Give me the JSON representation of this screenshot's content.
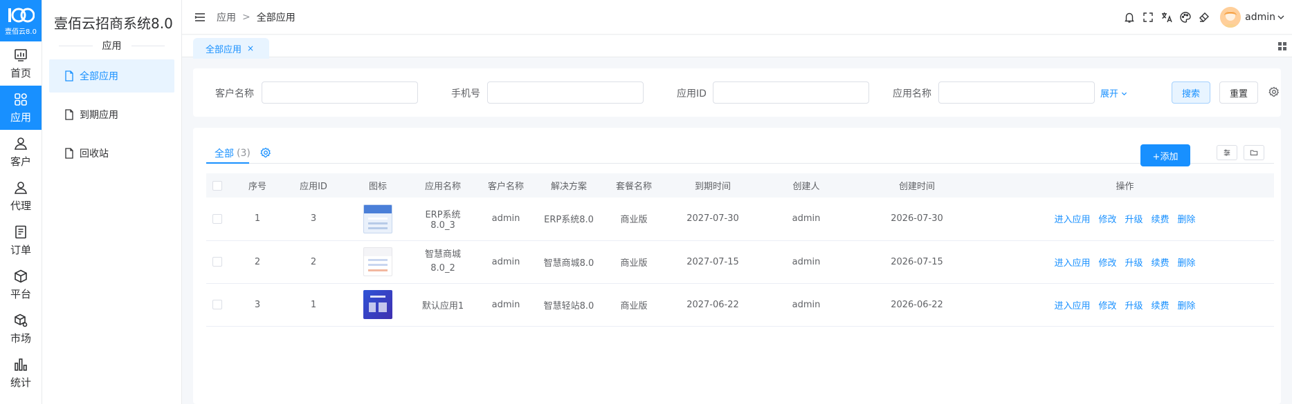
{
  "logo": {
    "text": "壹佰云8.0"
  },
  "rail": [
    {
      "id": "home",
      "label": "首页",
      "icon": "chart-icon",
      "active": false
    },
    {
      "id": "app",
      "label": "应用",
      "icon": "apps-grid-icon",
      "active": true
    },
    {
      "id": "customer",
      "label": "客户",
      "icon": "user-icon",
      "active": false
    },
    {
      "id": "agent",
      "label": "代理",
      "icon": "user-outline-icon",
      "active": false
    },
    {
      "id": "order",
      "label": "订单",
      "icon": "document-icon",
      "active": false
    },
    {
      "id": "platform",
      "label": "平台",
      "icon": "cube-icon",
      "active": false
    },
    {
      "id": "market",
      "label": "市场",
      "icon": "market-box-icon",
      "active": false
    },
    {
      "id": "stats",
      "label": "统计",
      "icon": "bar-chart-icon",
      "active": false
    }
  ],
  "subnav": {
    "brand": "壹佰云招商系统8.0",
    "section": "应用",
    "items": [
      {
        "label": "全部应用",
        "active": true
      },
      {
        "label": "到期应用",
        "active": false
      },
      {
        "label": "回收站",
        "active": false
      }
    ]
  },
  "header": {
    "breadcrumb": [
      "应用",
      "全部应用"
    ],
    "separator": ">",
    "user": "admin"
  },
  "tabs": {
    "active": "全部应用",
    "close": "×"
  },
  "filter": {
    "customer_label": "客户名称",
    "phone_label": "手机号",
    "app_id_label": "应用ID",
    "app_name_label": "应用名称",
    "expand": "展开",
    "search": "搜索",
    "reset": "重置"
  },
  "list": {
    "tab_label": "全部",
    "tab_count": "(3)",
    "add": "+添加",
    "columns": [
      "序号",
      "应用ID",
      "图标",
      "应用名称",
      "客户名称",
      "解决方案",
      "套餐名称",
      "到期时间",
      "创建人",
      "创建时间",
      "操作"
    ],
    "rows": [
      {
        "no": "1",
        "app_id": "3",
        "name": "ERP系统8.0_3",
        "customer": "admin",
        "solution": "ERP系统8.0",
        "package": "商业版",
        "expire": "2027-07-30",
        "creator": "admin",
        "created": "2026-07-30"
      },
      {
        "no": "2",
        "app_id": "2",
        "name": "智慧商城8.0_2",
        "customer": "admin",
        "solution": "智慧商城8.0",
        "package": "商业版",
        "expire": "2027-07-15",
        "creator": "admin",
        "created": "2026-07-15"
      },
      {
        "no": "3",
        "app_id": "1",
        "name": "默认应用1",
        "customer": "admin",
        "solution": "智慧轻站8.0",
        "package": "商业版",
        "expire": "2027-06-22",
        "creator": "admin",
        "created": "2026-06-22"
      }
    ],
    "actions": [
      "进入应用",
      "修改",
      "升级",
      "续费",
      "删除"
    ]
  },
  "colors": {
    "primary": "#1890ff",
    "bg": "#f5f7fa"
  }
}
